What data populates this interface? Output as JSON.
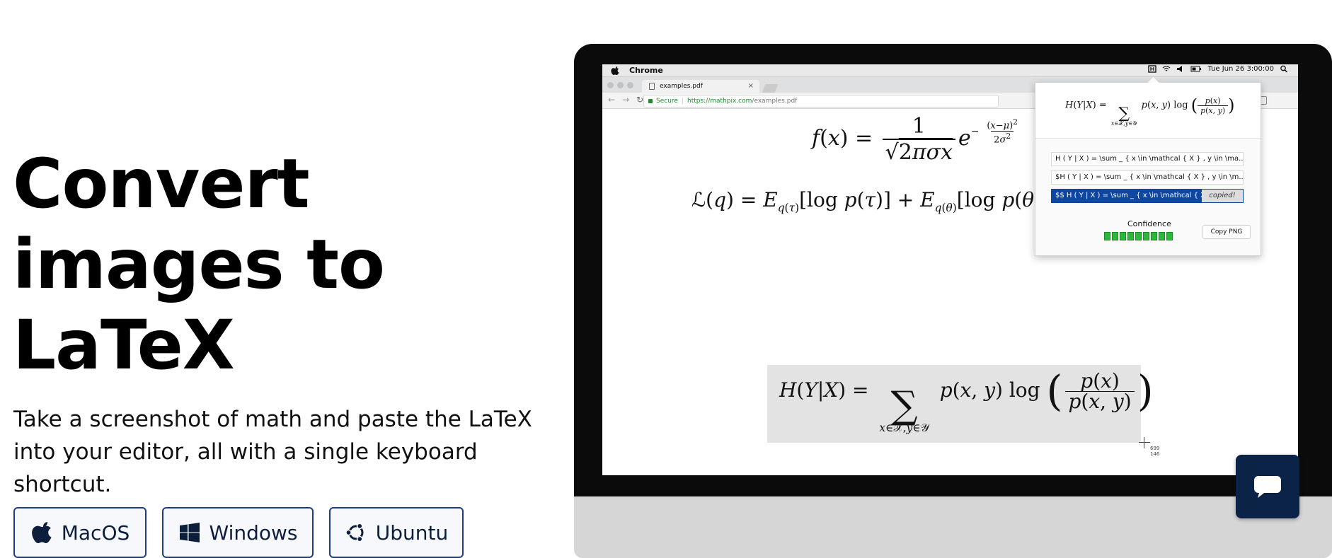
{
  "hero": {
    "title_lines": [
      "Convert",
      "images to",
      "LaTeX"
    ],
    "subtitle": "Take a screenshot of math and paste the LaTeX into your editor, all with a single keyboard shortcut."
  },
  "os_buttons": [
    {
      "label": "MacOS",
      "icon": "apple-icon"
    },
    {
      "label": "Windows",
      "icon": "windows-icon"
    },
    {
      "label": "Ubuntu",
      "icon": "ubuntu-icon"
    }
  ],
  "mac_menubar": {
    "app_name": "Chrome",
    "datetime": "Tue Jun 26  3:00:00"
  },
  "browser": {
    "tab_title": "examples.pdf",
    "tab_close": "×",
    "secure_label": "Secure",
    "url_host": "https://mathpix.com",
    "url_path": "/examples.pdf"
  },
  "pdf": {
    "cursor_coords_x": "699",
    "cursor_coords_y": "146"
  },
  "popup": {
    "results": [
      "H ( Y | X ) = \\sum _ { x \\in \\mathcal { X } , y \\in \\ma...",
      "$H ( Y | X ) = \\sum _ { x \\in \\mathcal { X } , y \\in \\m...",
      "$$ H ( Y | X ) = \\sum _ { x \\in \\mathcal { X } , y \\in \\m"
    ],
    "copied_label": "copied!",
    "confidence_label": "Confidence",
    "confidence_segments": 9,
    "copy_png_label": "Copy PNG"
  },
  "colors": {
    "button_border": "#1f3d7a",
    "selected_row": "#0d47a1",
    "confidence_green": "#2db83d",
    "chat_button_bg": "#0a2347"
  },
  "chat_button": {
    "icon": "chat-bubble-icon"
  }
}
